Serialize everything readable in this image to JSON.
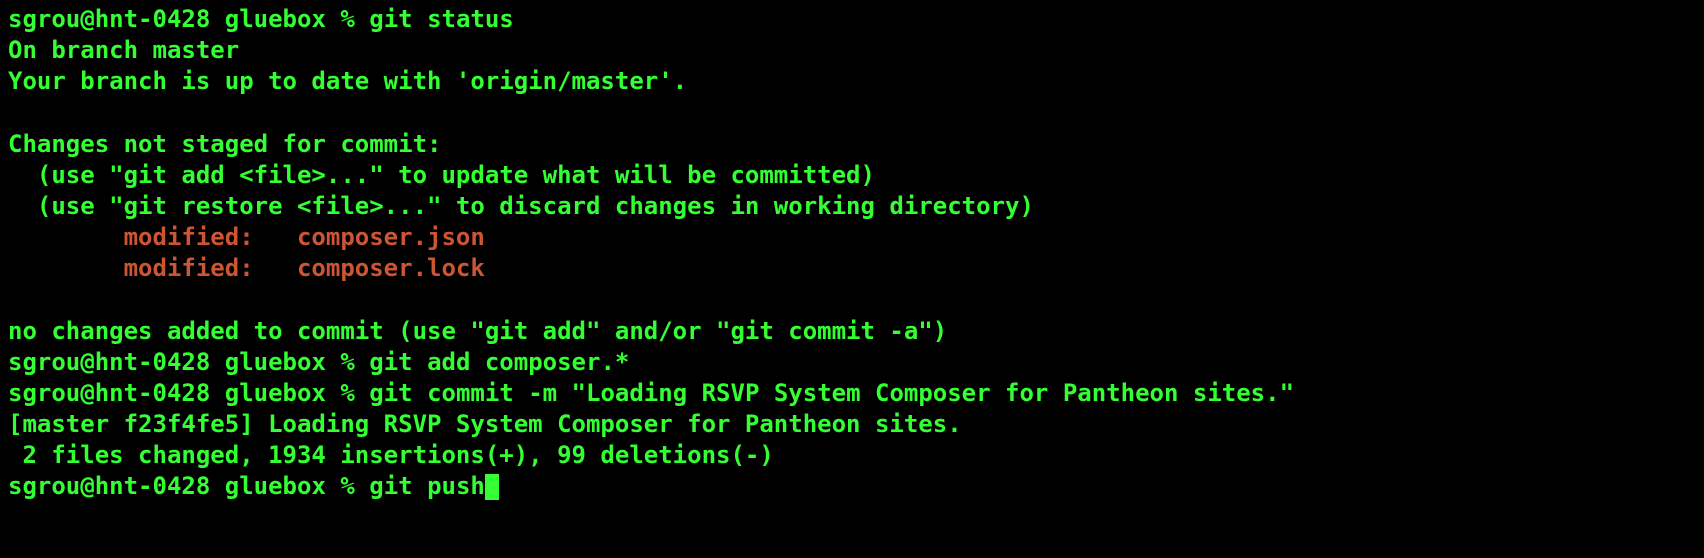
{
  "prompt1": {
    "user": "sgrou",
    "host": "hnt-0428",
    "dir": "gluebox",
    "cmd": "git status"
  },
  "status": {
    "branch_line": "On branch master",
    "uptodate_line": "Your branch is up to date with 'origin/master'.",
    "changes_header": "Changes not staged for commit:",
    "hint_add": "  (use \"git add <file>...\" to update what will be committed)",
    "hint_restore": "  (use \"git restore <file>...\" to discard changes in working directory)",
    "modified1": "        modified:   composer.json",
    "modified2": "        modified:   composer.lock",
    "no_changes": "no changes added to commit (use \"git add\" and/or \"git commit -a\")"
  },
  "prompt2": {
    "user": "sgrou",
    "host": "hnt-0428",
    "dir": "gluebox",
    "cmd": "git add composer.*"
  },
  "prompt3": {
    "user": "sgrou",
    "host": "hnt-0428",
    "dir": "gluebox",
    "cmd": "git commit -m \"Loading RSVP System Composer for Pantheon sites.\""
  },
  "commit_result": {
    "line1": "[master f23f4fe5] Loading RSVP System Composer for Pantheon sites.",
    "line2": " 2 files changed, 1934 insertions(+), 99 deletions(-)"
  },
  "prompt4": {
    "user": "sgrou",
    "host": "hnt-0428",
    "dir": "gluebox",
    "cmd": "git push"
  }
}
